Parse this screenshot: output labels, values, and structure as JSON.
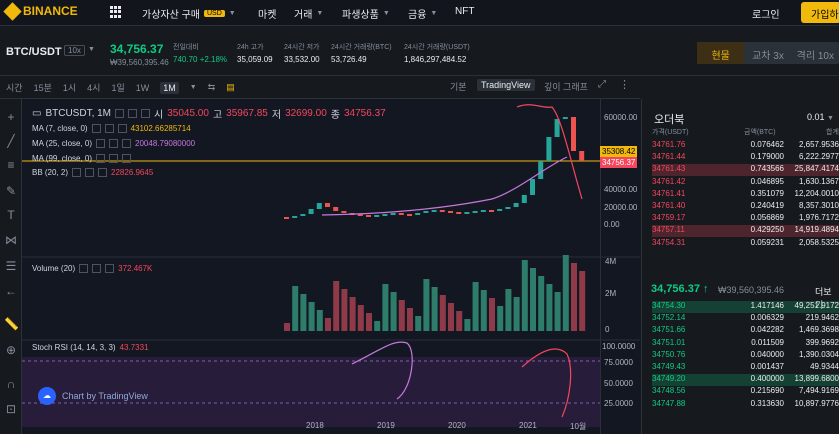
{
  "header": {
    "logo": "BINANCE",
    "nav": [
      {
        "label": "가상자산 구매",
        "badge": "USD"
      },
      {
        "label": "마켓"
      },
      {
        "label": "거래"
      },
      {
        "label": "파생상품"
      },
      {
        "label": "금융"
      },
      {
        "label": "NFT"
      }
    ],
    "login": "로그인",
    "register": "가입하"
  },
  "ticker": {
    "pair": "BTC/USDT",
    "leverage": "10x",
    "last_price": "34,756.37",
    "last_price_krw": "₩39,560,395.46",
    "stats": [
      {
        "label": "전일대비",
        "value": "740.70 +2.18%",
        "color": "#0ecb81"
      },
      {
        "label": "24h 고가",
        "value": "35,059.09"
      },
      {
        "label": "24시간 저가",
        "value": "33,532.00"
      },
      {
        "label": "24시간 거래량(BTC)",
        "value": "53,726.49"
      },
      {
        "label": "24시간 거래량(USDT)",
        "value": "1,846,297,484.52"
      }
    ],
    "tabs": [
      "현물",
      "교차 3x",
      "격리 10x"
    ]
  },
  "toolbar": {
    "items": [
      "시간",
      "15분",
      "1시",
      "4시",
      "1일",
      "1W",
      "1M"
    ],
    "active": "1M",
    "right": [
      "기본",
      "TradingView",
      "깊이 그래프"
    ]
  },
  "legend": {
    "symbol": "BTCUSDT, 1M",
    "o_label": "시",
    "o": "35045.00",
    "h_label": "고",
    "h": "35967.85",
    "l_label": "저",
    "l": "32699.00",
    "c_label": "종",
    "c": "34756.37",
    "ma7_label": "MA (7, close, 0)",
    "ma7": "43102.66285714",
    "ma25_label": "MA (25, close, 0)",
    "ma25": "20048.79080000",
    "ma99_label": "MA (99, close, 0)",
    "bb_label": "BB (20, 2)",
    "bb": "22826.9645",
    "vol_label": "Volume (20)",
    "vol": "372.467K",
    "rsi_label": "Stoch RSI (14, 14, 3, 3)",
    "rsi": "43.7331"
  },
  "price_axis": {
    "ticks": [
      "60000.00",
      "40000.00",
      "20000.00",
      "0.00"
    ],
    "marker_high": "35308.42",
    "marker_last": "34756.37",
    "vol_ticks": [
      "4M",
      "2M",
      "0"
    ],
    "rsi_ticks": [
      "100.0000",
      "75.0000",
      "50.0000",
      "25.0000"
    ]
  },
  "x_axis": [
    "2018",
    "2019",
    "2020",
    "2021",
    "10월"
  ],
  "watermark": "Chart by TradingView",
  "orderbook": {
    "title": "오더북",
    "precision": "0.01",
    "headers": [
      "가격(USDT)",
      "금액(BTC)",
      "합계"
    ],
    "asks": [
      [
        "34761.76",
        "0.076462",
        "2,657.9536"
      ],
      [
        "34761.44",
        "0.179000",
        "6,222.2977"
      ],
      [
        "34761.43",
        "0.743566",
        "25,847.4174"
      ],
      [
        "34761.42",
        "0.046895",
        "1,630.1367"
      ],
      [
        "34761.41",
        "0.351079",
        "12,204.0010"
      ],
      [
        "34761.40",
        "0.240419",
        "8,357.3010"
      ],
      [
        "34759.17",
        "0.056869",
        "1,976.7172"
      ],
      [
        "34757.11",
        "0.429250",
        "14,919.4894"
      ],
      [
        "34754.31",
        "0.059231",
        "2,058.5325"
      ]
    ],
    "last": "34,756.37 ↑",
    "last_krw": "₩39,560,395.46",
    "more": "더보기",
    "bids": [
      [
        "34754.30",
        "1.417146",
        "49,251.9172"
      ],
      [
        "34752.14",
        "0.006329",
        "219.9462"
      ],
      [
        "34751.66",
        "0.042282",
        "1,469.3698"
      ],
      [
        "34751.01",
        "0.011509",
        "399.9692"
      ],
      [
        "34750.76",
        "0.040000",
        "1,390.0304"
      ],
      [
        "34749.43",
        "0.001437",
        "49.9344"
      ],
      [
        "34749.20",
        "0.400000",
        "13,899.6800"
      ],
      [
        "34748.56",
        "0.215690",
        "7,494.9169"
      ],
      [
        "34747.88",
        "0.313630",
        "10,897.9776"
      ]
    ]
  },
  "colors": {
    "up": "#0ecb81",
    "down": "#f6465d",
    "accent": "#f0b90b"
  }
}
